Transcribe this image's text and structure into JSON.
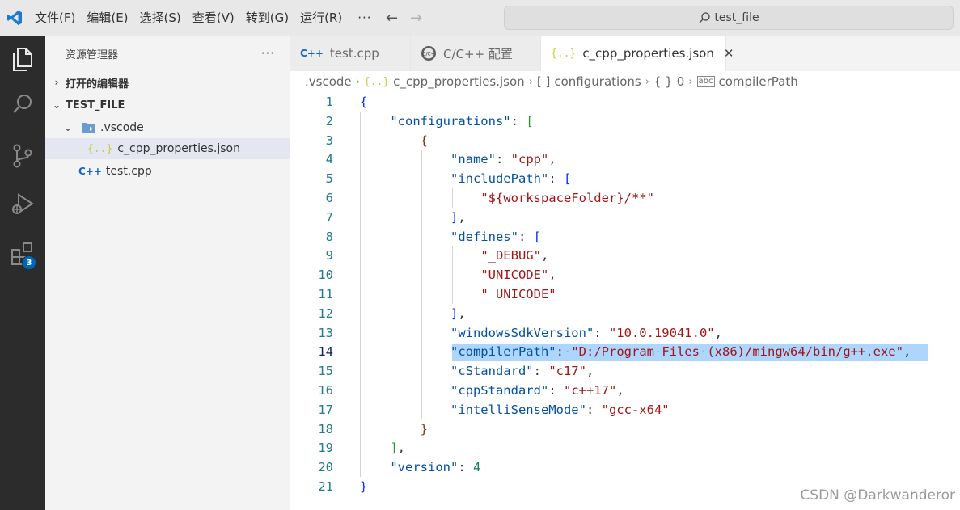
{
  "titlebar": {
    "menu": [
      "文件(F)",
      "编辑(E)",
      "选择(S)",
      "查看(V)",
      "转到(G)",
      "运行(R)"
    ],
    "more": "···",
    "search_text": "test_file"
  },
  "activity": {
    "extensions_badge": "3"
  },
  "sidebar": {
    "title": "资源管理器",
    "more": "···",
    "open_editors": "打开的编辑器",
    "folder": "TEST_FILE",
    "vscode_folder": ".vscode",
    "json_file": "c_cpp_properties.json",
    "cpp_file": "test.cpp"
  },
  "tabs": [
    {
      "label": "test.cpp"
    },
    {
      "label": "C/C++ 配置"
    },
    {
      "label": "c_cpp_properties.json"
    }
  ],
  "breadcrumb": {
    "folder": ".vscode",
    "file": "c_cpp_properties.json",
    "array": "configurations",
    "index": "0",
    "prop": "compilerPath"
  },
  "editor": {
    "line_numbers": [
      "1",
      "2",
      "3",
      "4",
      "5",
      "6",
      "7",
      "8",
      "9",
      "10",
      "11",
      "12",
      "13",
      "14",
      "15",
      "16",
      "17",
      "18",
      "19",
      "20",
      "21"
    ],
    "current_line": 14,
    "code": {
      "k_configurations": "\"configurations\"",
      "k_name": "\"name\"",
      "v_name": "\"cpp\"",
      "k_includePath": "\"includePath\"",
      "v_include": "\"${workspaceFolder}/**\"",
      "k_defines": "\"defines\"",
      "v_debug": "\"_DEBUG\"",
      "v_unicode": "\"UNICODE\"",
      "v_unicode2": "\"_UNICODE\"",
      "k_sdk": "\"windowsSdkVersion\"",
      "v_sdk": "\"10.0.19041.0\"",
      "k_compiler": "\"compilerPath\"",
      "v_compiler_a": "\"D:/Program",
      "v_compiler_b": "Files",
      "v_compiler_c": "(x86)/mingw64/bin/g++.exe\"",
      "k_cstd": "\"cStandard\"",
      "v_cstd": "\"c17\"",
      "k_cppstd": "\"cppStandard\"",
      "v_cppstd": "\"c++17\"",
      "k_intelli": "\"intelliSenseMode\"",
      "v_intelli": "\"gcc-x64\"",
      "k_version": "\"version\"",
      "v_version": "4"
    }
  },
  "watermark": "CSDN @Darkwanderor",
  "colors": {
    "activitybar": "#2c2c2c",
    "sidebar": "#f3f3f3",
    "selection": "#add6ff",
    "badge": "#0066b8"
  }
}
